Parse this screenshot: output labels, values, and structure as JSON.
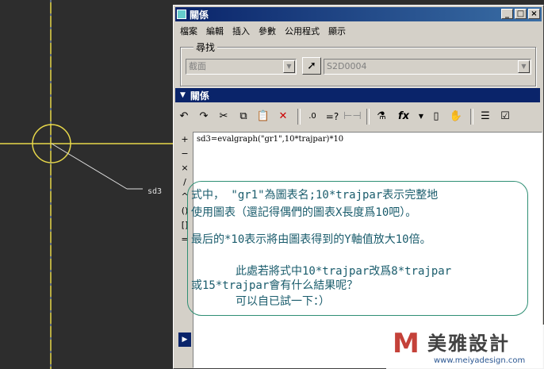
{
  "cad": {
    "dim_label": "sd3"
  },
  "window": {
    "title": "關係",
    "min": "_",
    "max": "□",
    "close": "×"
  },
  "menu": [
    "檔案",
    "編輯",
    "插入",
    "參數",
    "公用程式",
    "顯示"
  ],
  "find": {
    "legend": "尋找",
    "type_value": "截面",
    "item_value": "S2D0004"
  },
  "panel": {
    "title": "關係"
  },
  "toolbar": {
    "fx_label": "fx",
    "eq_label": "=?"
  },
  "ops": [
    "+",
    "−",
    "×",
    "/",
    "^",
    "()",
    "[]",
    "="
  ],
  "relation": "sd3=evalgraph(\"gr1\",10*trajpar)*10",
  "annotation": {
    "line1": "式中， \"gr1\"為圖表名;10*trajpar表示完整地",
    "line2": "使用圖表（還記得偶們的圖表X長度爲10吧）。",
    "line3": "最后的*10表示將由圖表得到的Y軸值放大10倍。",
    "line4": "此處若將式中10*trajpar改爲8*trajpar",
    "line5": "或15*trajpar會有什么結果呢？",
    "line6": "可以自已試一下：）"
  },
  "logo": {
    "name": "美雅設計",
    "url": "www.meiyadesign.com"
  },
  "colors": {
    "title_bg": "#0a246a",
    "cad_bg": "#2d2d2d",
    "note_text": "#1a5c6c"
  }
}
